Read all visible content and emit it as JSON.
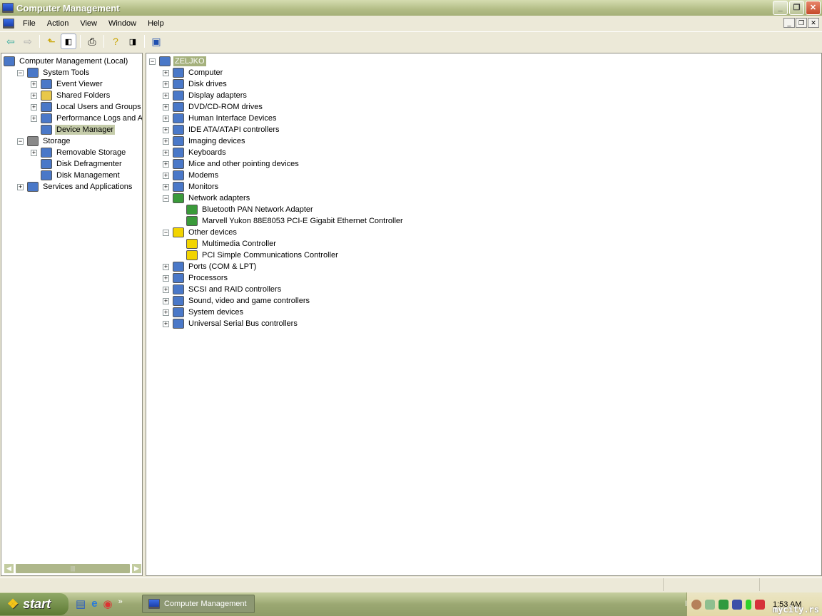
{
  "window": {
    "title": "Computer Management",
    "minimize": "_",
    "maximize": "❐",
    "close": "✕"
  },
  "menu": [
    "File",
    "Action",
    "View",
    "Window",
    "Help"
  ],
  "toolbar_icons": [
    "back-icon",
    "forward-icon",
    "up-folder-icon",
    "show-hide-tree-icon",
    "print-icon",
    "help-icon",
    "properties-icon",
    "scan-hardware-icon"
  ],
  "left_tree": [
    {
      "label": "Computer Management (Local)",
      "level": 0,
      "exp": "",
      "icon": "computer-icon"
    },
    {
      "label": "System Tools",
      "level": 1,
      "exp": "-",
      "icon": "tools-icon"
    },
    {
      "label": "Event Viewer",
      "level": 2,
      "exp": "+",
      "icon": "event-viewer-icon"
    },
    {
      "label": "Shared Folders",
      "level": 2,
      "exp": "+",
      "icon": "shared-folder-icon"
    },
    {
      "label": "Local Users and Groups",
      "level": 2,
      "exp": "+",
      "icon": "users-icon"
    },
    {
      "label": "Performance Logs and Alerts",
      "level": 2,
      "exp": "+",
      "icon": "performance-icon"
    },
    {
      "label": "Device Manager",
      "level": 2,
      "exp": "",
      "icon": "device-manager-icon",
      "selected": true
    },
    {
      "label": "Storage",
      "level": 1,
      "exp": "-",
      "icon": "storage-icon"
    },
    {
      "label": "Removable Storage",
      "level": 2,
      "exp": "+",
      "icon": "removable-storage-icon"
    },
    {
      "label": "Disk Defragmenter",
      "level": 2,
      "exp": "",
      "icon": "defrag-icon"
    },
    {
      "label": "Disk Management",
      "level": 2,
      "exp": "",
      "icon": "disk-management-icon"
    },
    {
      "label": "Services and Applications",
      "level": 1,
      "exp": "+",
      "icon": "services-icon"
    }
  ],
  "right_tree": [
    {
      "label": "ZELJKO",
      "level": 0,
      "exp": "-",
      "icon": "computer-icon",
      "highlight": true
    },
    {
      "label": "Computer",
      "level": 1,
      "exp": "+",
      "icon": "computer-icon"
    },
    {
      "label": "Disk drives",
      "level": 1,
      "exp": "+",
      "icon": "disk-drive-icon"
    },
    {
      "label": "Display adapters",
      "level": 1,
      "exp": "+",
      "icon": "display-adapter-icon"
    },
    {
      "label": "DVD/CD-ROM drives",
      "level": 1,
      "exp": "+",
      "icon": "cdrom-icon"
    },
    {
      "label": "Human Interface Devices",
      "level": 1,
      "exp": "+",
      "icon": "hid-icon"
    },
    {
      "label": "IDE ATA/ATAPI controllers",
      "level": 1,
      "exp": "+",
      "icon": "ide-icon"
    },
    {
      "label": "Imaging devices",
      "level": 1,
      "exp": "+",
      "icon": "imaging-icon"
    },
    {
      "label": "Keyboards",
      "level": 1,
      "exp": "+",
      "icon": "keyboard-icon"
    },
    {
      "label": "Mice and other pointing devices",
      "level": 1,
      "exp": "+",
      "icon": "mouse-icon"
    },
    {
      "label": "Modems",
      "level": 1,
      "exp": "+",
      "icon": "modem-icon"
    },
    {
      "label": "Monitors",
      "level": 1,
      "exp": "+",
      "icon": "monitor-icon"
    },
    {
      "label": "Network adapters",
      "level": 1,
      "exp": "-",
      "icon": "network-adapter-icon"
    },
    {
      "label": "Bluetooth PAN Network Adapter",
      "level": 2,
      "exp": "",
      "icon": "network-adapter-icon"
    },
    {
      "label": "Marvell Yukon 88E8053 PCI-E Gigabit Ethernet Controller",
      "level": 2,
      "exp": "",
      "icon": "network-adapter-icon"
    },
    {
      "label": "Other devices",
      "level": 1,
      "exp": "-",
      "icon": "unknown-device-icon"
    },
    {
      "label": "Multimedia Controller",
      "level": 2,
      "exp": "",
      "icon": "warning-device-icon"
    },
    {
      "label": "PCI Simple Communications Controller",
      "level": 2,
      "exp": "",
      "icon": "warning-device-icon"
    },
    {
      "label": "Ports (COM & LPT)",
      "level": 1,
      "exp": "+",
      "icon": "port-icon"
    },
    {
      "label": "Processors",
      "level": 1,
      "exp": "+",
      "icon": "processor-icon"
    },
    {
      "label": "SCSI and RAID controllers",
      "level": 1,
      "exp": "+",
      "icon": "scsi-icon"
    },
    {
      "label": "Sound, video and game controllers",
      "level": 1,
      "exp": "+",
      "icon": "sound-icon"
    },
    {
      "label": "System devices",
      "level": 1,
      "exp": "+",
      "icon": "system-devices-icon"
    },
    {
      "label": "Universal Serial Bus controllers",
      "level": 1,
      "exp": "+",
      "icon": "usb-icon"
    }
  ],
  "taskbar": {
    "start": "start",
    "task": "Computer Management",
    "lang": "EN",
    "clock": "1:53 AM",
    "more": "»"
  },
  "watermark": "mycity.rs",
  "colors": {
    "title": "#b2bc85",
    "selection": "#a5b17d"
  }
}
